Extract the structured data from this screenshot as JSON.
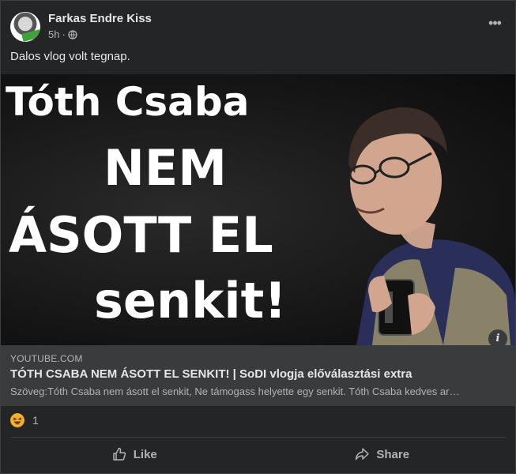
{
  "post": {
    "author": "Farkas Endre Kiss",
    "time": "5h",
    "visibility_icon": "globe-icon",
    "text": "Dalos vlog volt tegnap."
  },
  "thumbnail": {
    "line1": "Tóth Csaba",
    "line2": "NEM",
    "line3": "ÁSOTT EL",
    "line4": "senkit!"
  },
  "link": {
    "domain": "YOUTUBE.COM",
    "title": "TÓTH CSABA NEM ÁSOTT EL SENKIT! | SoDI vlogja előválasztási extra",
    "description": "Szöveg:Tóth Csaba nem ásott el senkit, Ne támogass helyette egy senkit. Tóth Csaba kedves ar…"
  },
  "reactions": {
    "icon": "haha-icon",
    "count": "1"
  },
  "actions": {
    "like_label": "Like",
    "share_label": "Share"
  },
  "colors": {
    "background": "#242526",
    "link_box": "#3a3b3c",
    "text_primary": "#e4e6eb",
    "text_secondary": "#b0b3b8",
    "reaction_yellow": "#f7b125"
  }
}
